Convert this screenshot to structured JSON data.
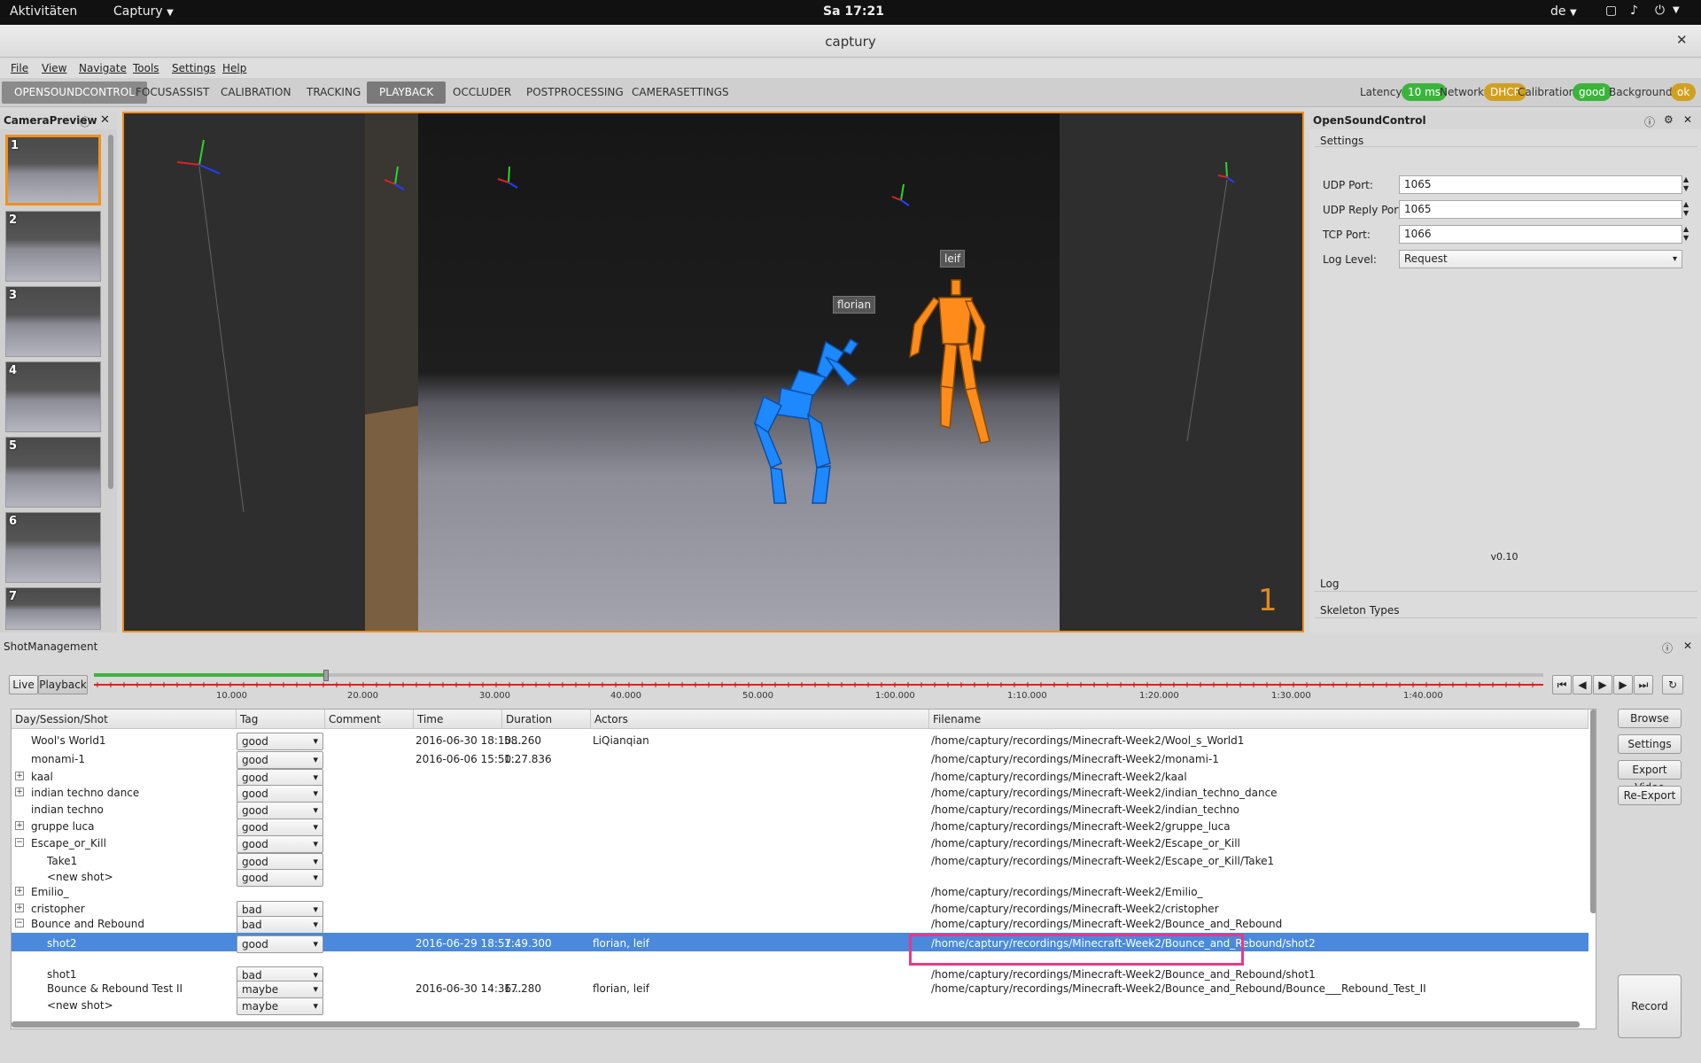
{
  "system": {
    "activities": "Aktivitäten",
    "app_menu": "Captury",
    "clock": "Sa 17:21",
    "keyboard_layout": "de"
  },
  "window": {
    "title": "captury"
  },
  "menu": [
    "File",
    "View",
    "Navigate",
    "Tools",
    "Settings",
    "Help"
  ],
  "tabs": [
    "OPENSOUNDCONTROL",
    "FOCUSASSIST",
    "CALIBRATION",
    "TRACKING",
    "PLAYBACK",
    "OCCLUDER",
    "POSTPROCESSING",
    "CAMERASETTINGS"
  ],
  "active_tab": "PLAYBACK",
  "status": {
    "latency_label": "Latency:",
    "latency_value": "10 ms",
    "network_label": "Network:",
    "network_value": "DHCP",
    "calibration_label": "Calibration:",
    "calibration_value": "good",
    "background_label": "Background:",
    "background_value": "ok",
    "colors": {
      "green": "#3cb43c",
      "amber": "#d2a020"
    }
  },
  "camera_preview": {
    "title": "CameraPreview",
    "thumbnails": [
      "1",
      "2",
      "3",
      "4",
      "5",
      "6",
      "7"
    ],
    "selected": "1"
  },
  "viewport": {
    "camera_number": "1",
    "actors": [
      "florian",
      "leif"
    ],
    "colors": {
      "florian": "#1e88ff",
      "leif": "#ff8c1a",
      "border": "#f0901e"
    }
  },
  "osc": {
    "title": "OpenSoundControl",
    "settings_label": "Settings",
    "udp_port_label": "UDP Port:",
    "udp_port": "1065",
    "udp_reply_label": "UDP Reply Port:",
    "udp_reply": "1065",
    "tcp_port_label": "TCP Port:",
    "tcp_port": "1066",
    "log_level_label": "Log Level:",
    "log_level": "Request",
    "version": "v0.10",
    "log_section": "Log",
    "skeleton_section": "Skeleton Types"
  },
  "shot_management": {
    "title": "ShotManagement",
    "live_button": "Live",
    "playback_button": "Playback",
    "timeline_ticks": [
      "10.000",
      "20.000",
      "30.000",
      "40.000",
      "50.000",
      "1:00.000",
      "1:10.000",
      "1:20.000",
      "1:30.000",
      "1:40.000"
    ],
    "columns": [
      "Day/Session/Shot",
      "Tag",
      "Comment",
      "Time",
      "Duration",
      "Actors",
      "Filename"
    ],
    "rows": [
      {
        "name": "Wool's World1",
        "tag": "good",
        "comment": "",
        "time": "2016-06-30 18:10...",
        "duration": "58.260",
        "actors": "LiQianqian",
        "filename": "/home/captury/recordings/Minecraft-Week2/Wool_s_World1",
        "expander": "",
        "indent": 0
      },
      {
        "name": "monami-1",
        "tag": "good",
        "comment": "",
        "time": "2016-06-06 15:50...",
        "duration": "1:27.836",
        "actors": "",
        "filename": "/home/captury/recordings/Minecraft-Week2/monami-1",
        "expander": "",
        "indent": 0
      },
      {
        "name": "kaal",
        "tag": "good",
        "comment": "",
        "time": "",
        "duration": "",
        "actors": "",
        "filename": "/home/captury/recordings/Minecraft-Week2/kaal",
        "expander": "+",
        "indent": 0
      },
      {
        "name": "indian techno dance",
        "tag": "good",
        "comment": "",
        "time": "",
        "duration": "",
        "actors": "",
        "filename": "/home/captury/recordings/Minecraft-Week2/indian_techno_dance",
        "expander": "+",
        "indent": 0
      },
      {
        "name": "indian techno",
        "tag": "good",
        "comment": "",
        "time": "",
        "duration": "",
        "actors": "",
        "filename": "/home/captury/recordings/Minecraft-Week2/indian_techno",
        "expander": "",
        "indent": 0
      },
      {
        "name": "gruppe luca",
        "tag": "good",
        "comment": "",
        "time": "",
        "duration": "",
        "actors": "",
        "filename": "/home/captury/recordings/Minecraft-Week2/gruppe_luca",
        "expander": "+",
        "indent": 0
      },
      {
        "name": "Escape_or_Kill",
        "tag": "good",
        "comment": "",
        "time": "",
        "duration": "",
        "actors": "",
        "filename": "/home/captury/recordings/Minecraft-Week2/Escape_or_Kill",
        "expander": "−",
        "indent": 0
      },
      {
        "name": "Take1",
        "tag": "good",
        "comment": "",
        "time": "",
        "duration": "",
        "actors": "",
        "filename": "/home/captury/recordings/Minecraft-Week2/Escape_or_Kill/Take1",
        "expander": "",
        "indent": 1
      },
      {
        "name": "<new shot>",
        "tag": "good",
        "comment": "",
        "time": "",
        "duration": "",
        "actors": "",
        "filename": "",
        "expander": "",
        "indent": 1
      },
      {
        "name": "Emilio_",
        "tag": "",
        "comment": "",
        "time": "",
        "duration": "",
        "actors": "",
        "filename": "/home/captury/recordings/Minecraft-Week2/Emilio_",
        "expander": "+",
        "indent": 0
      },
      {
        "name": "cristopher",
        "tag": "bad",
        "comment": "",
        "time": "",
        "duration": "",
        "actors": "",
        "filename": "/home/captury/recordings/Minecraft-Week2/cristopher",
        "expander": "+",
        "indent": 0
      },
      {
        "name": "Bounce and Rebound",
        "tag": "bad",
        "comment": "",
        "time": "",
        "duration": "",
        "actors": "",
        "filename": "/home/captury/recordings/Minecraft-Week2/Bounce_and_Rebound",
        "expander": "−",
        "indent": 0
      },
      {
        "name": "shot2",
        "tag": "good",
        "comment": "",
        "time": "2016-06-29 18:57...",
        "duration": "1:49.300",
        "actors": "florian, leif",
        "filename": "/home/captury/recordings/Minecraft-Week2/Bounce_and_Rebound/shot2",
        "expander": "",
        "indent": 1,
        "selected": true
      },
      {
        "name": "shot1",
        "tag": "bad",
        "comment": "",
        "time": "",
        "duration": "",
        "actors": "",
        "filename": "/home/captury/recordings/Minecraft-Week2/Bounce_and_Rebound/shot1",
        "expander": "",
        "indent": 1
      },
      {
        "name": "Bounce & Rebound Test II",
        "tag": "maybe",
        "comment": "",
        "time": "2016-06-30 14:36...",
        "duration": "17.280",
        "actors": "florian, leif",
        "filename": "/home/captury/recordings/Minecraft-Week2/Bounce_and_Rebound/Bounce___Rebound_Test_II",
        "expander": "",
        "indent": 1
      },
      {
        "name": "<new shot>",
        "tag": "maybe",
        "comment": "",
        "time": "",
        "duration": "",
        "actors": "",
        "filename": "",
        "expander": "",
        "indent": 1
      }
    ],
    "buttons": {
      "browse": "Browse",
      "settings": "Settings",
      "export_video": "Export Video",
      "re_export": "Re-Export",
      "record": "Record"
    },
    "playback_progress": 0.16,
    "highlight_color": "#e8388a"
  }
}
